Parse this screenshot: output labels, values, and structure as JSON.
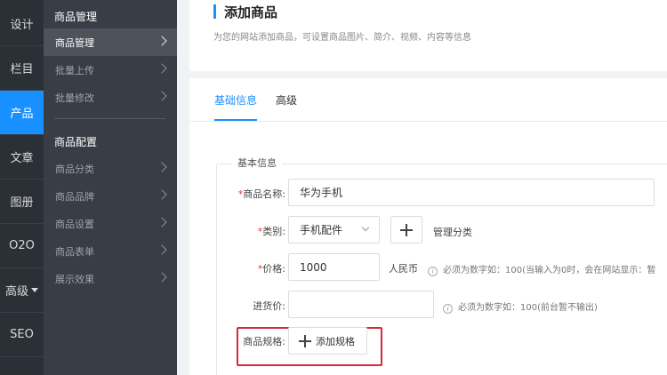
{
  "rail": {
    "items": [
      {
        "label": "设计"
      },
      {
        "label": "栏目"
      },
      {
        "label": "产品"
      },
      {
        "label": "文章"
      },
      {
        "label": "图册"
      },
      {
        "label": "O2O"
      },
      {
        "label": "高级"
      },
      {
        "label": "SEO"
      }
    ]
  },
  "submenu": {
    "group1": {
      "title": "商品管理",
      "items": [
        {
          "label": "商品管理"
        },
        {
          "label": "批量上传"
        },
        {
          "label": "批量修改"
        }
      ]
    },
    "group2": {
      "title": "商品配置",
      "items": [
        {
          "label": "商品分类"
        },
        {
          "label": "商品品牌"
        },
        {
          "label": "商品设置"
        },
        {
          "label": "商品表单"
        },
        {
          "label": "展示效果"
        }
      ]
    }
  },
  "header": {
    "title": "添加商品",
    "description": "为您的网站添加商品，可设置商品图片、简介、视频、内容等信息"
  },
  "tabs": [
    {
      "label": "基础信息"
    },
    {
      "label": "高级"
    }
  ],
  "form": {
    "section_title": "基本信息",
    "name": {
      "label": "商品名称:",
      "value": "华为手机"
    },
    "category": {
      "label": "类别:",
      "value": "手机配件",
      "manage_label": "管理分类"
    },
    "price": {
      "label": "价格:",
      "value": "1000",
      "unit": "人民币",
      "hint": "必须为数字如：100(当输入为0时，会在网站显示：暂"
    },
    "cost": {
      "label": "进货价:",
      "value": "",
      "hint": "必须为数字如：100(前台暂不输出)"
    },
    "spec": {
      "label": "商品规格:",
      "add_label": "添加规格"
    },
    "required_mark": "*"
  },
  "colors": {
    "accent": "#1890ff",
    "highlight": "#d8293d"
  }
}
